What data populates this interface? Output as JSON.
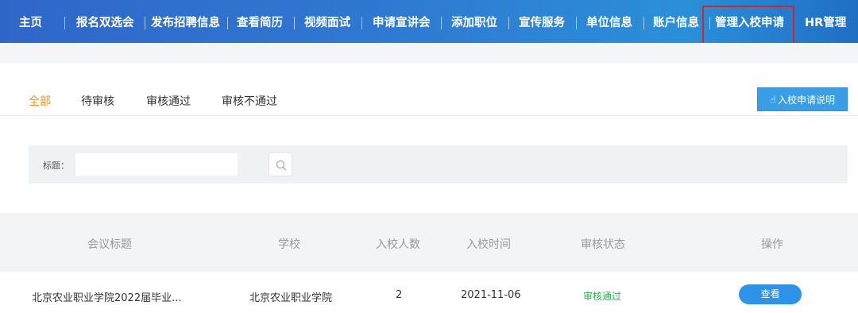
{
  "nav": {
    "items": [
      {
        "label": "主页"
      },
      {
        "label": "报名双选会"
      },
      {
        "label": "发布招聘信息"
      },
      {
        "label": "查看简历"
      },
      {
        "label": "视频面试"
      },
      {
        "label": "申请宣讲会"
      },
      {
        "label": "添加职位"
      },
      {
        "label": "宣传服务"
      },
      {
        "label": "单位信息"
      },
      {
        "label": "账户信息"
      },
      {
        "label": "管理入校申请"
      },
      {
        "label": "HR管理"
      }
    ],
    "highlighted": "管理入校申请",
    "highlight_color": "#d9231e"
  },
  "tabs": {
    "items": [
      {
        "label": "全部"
      },
      {
        "label": "待审核"
      },
      {
        "label": "审核通过"
      },
      {
        "label": "审核不通过"
      }
    ],
    "active": "全部",
    "active_color": "#f39322"
  },
  "help_button": {
    "icon": "hand-pointer-icon",
    "label": "入校申请说明"
  },
  "search": {
    "label": "标题：",
    "value": "",
    "button_icon": "search-icon"
  },
  "table": {
    "headers": {
      "title": "会议标题",
      "school": "学校",
      "count": "入校人数",
      "date": "入校时间",
      "status": "审核状态",
      "action": "操作"
    },
    "rows": [
      {
        "title": "北京农业职业学院2022届毕业...",
        "school": "北京农业职业学院",
        "count": "2",
        "date": "2021-11-06",
        "status": "审核通过",
        "action": "查看"
      }
    ],
    "status_color": "#25b34b"
  },
  "colors": {
    "nav_bg": "#2f79d2",
    "button_blue": "#2d93e8"
  }
}
